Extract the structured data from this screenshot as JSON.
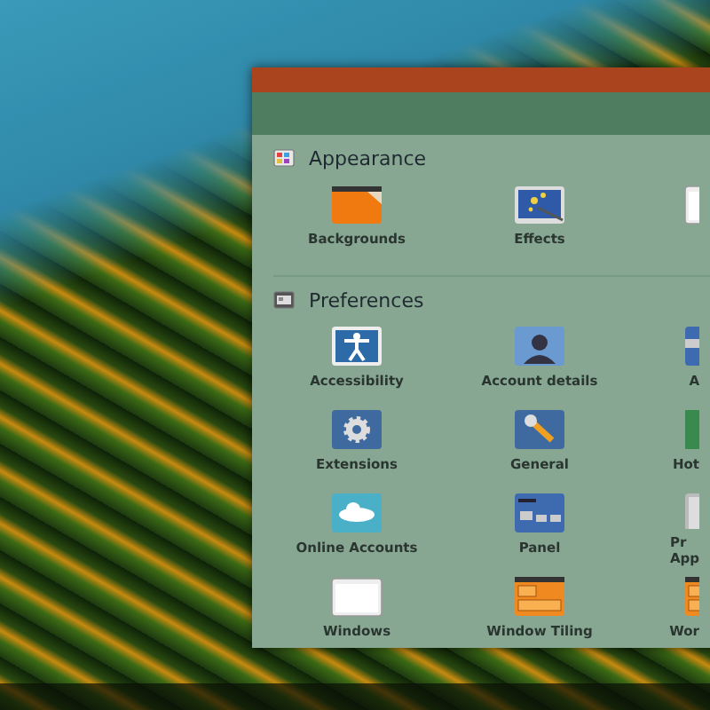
{
  "sections": [
    {
      "title": "Appearance",
      "kind": "palette",
      "items": [
        {
          "label": "Backgrounds",
          "kind": "folder"
        },
        {
          "label": "Effects",
          "kind": "wand"
        },
        {
          "kind": "blank"
        }
      ]
    },
    {
      "title": "Preferences",
      "kind": "prefs",
      "items": [
        {
          "label": "Accessibility",
          "kind": "access"
        },
        {
          "label": "Account details",
          "kind": "person"
        },
        {
          "label": "A",
          "kind": "applets"
        },
        {
          "label": "Extensions",
          "kind": "gear"
        },
        {
          "label": "General",
          "kind": "wrench"
        },
        {
          "label": "Hot",
          "kind": "hot"
        },
        {
          "label": "Online Accounts",
          "kind": "cloud"
        },
        {
          "label": "Panel",
          "kind": "panel"
        },
        {
          "label": "Pr\nApp",
          "kind": "privacy"
        },
        {
          "label": "Windows",
          "kind": "windows"
        },
        {
          "label": "Window Tiling",
          "kind": "tiling"
        },
        {
          "label": "Wor",
          "kind": "workspace"
        }
      ]
    }
  ]
}
